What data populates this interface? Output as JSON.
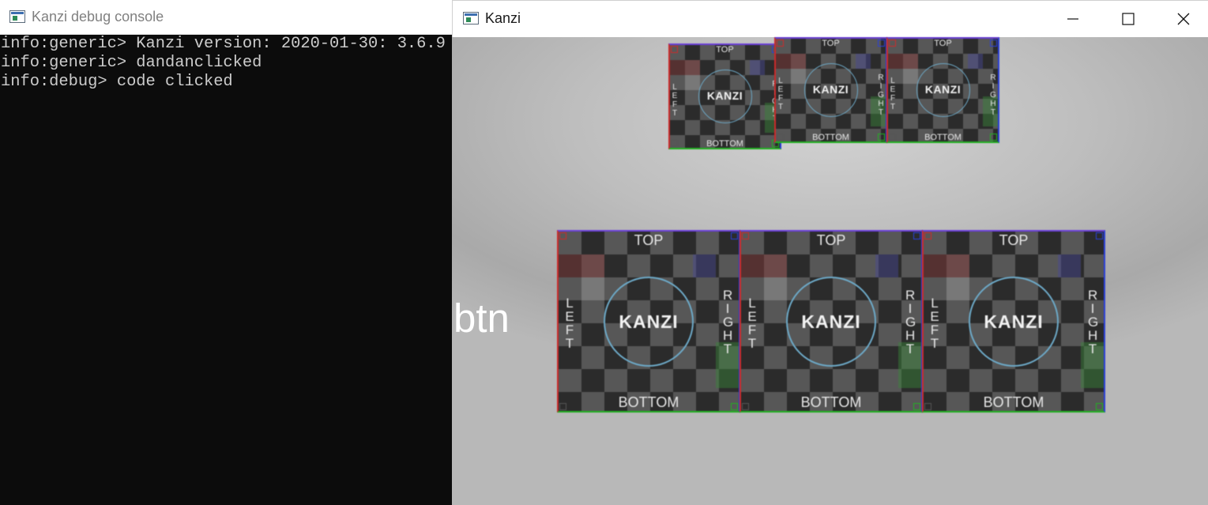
{
  "console": {
    "title": "Kanzi debug console",
    "lines": [
      "info:generic> Kanzi version: 2020-01-30: 3.6.9",
      "info:generic> dandanclicked",
      "info:debug> code clicked"
    ]
  },
  "kanzi_window": {
    "title": "Kanzi",
    "minimize_icon": "minimize-icon",
    "maximize_icon": "maximize-icon",
    "close_icon": "close-icon"
  },
  "scene": {
    "btn_label": "btn",
    "tile_logo": "KANZI",
    "tile_top": "TOP",
    "tile_bottom": "BOTTOM",
    "tile_left": "LEFT",
    "tile_right": "RIGHT",
    "top_row_count": 3,
    "bottom_row_count": 3
  },
  "colors": {
    "console_bg": "#0c0c0c",
    "console_text": "#cccccc",
    "edge_left": "#cc2a2a",
    "edge_right": "#2a3fd8",
    "edge_bottom": "#22b022",
    "ring": "#6ca8c6"
  }
}
